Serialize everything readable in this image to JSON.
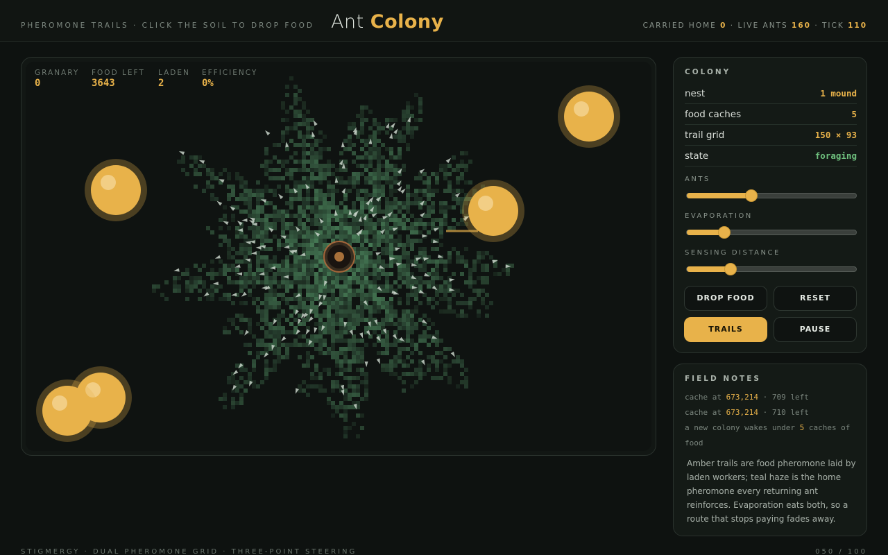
{
  "header": {
    "tagline": "Pheromone trails · click the soil to drop food",
    "title_light": "Ant",
    "title_accent": "Colony",
    "stats": {
      "carried_home_label": "Carried home",
      "carried_home": "0",
      "live_ants_label": "Live ants",
      "live_ants": "160",
      "tick_label": "Tick",
      "tick": "110"
    }
  },
  "hud": [
    {
      "label": "Granary",
      "value": "0"
    },
    {
      "label": "Food left",
      "value": "3643"
    },
    {
      "label": "Laden",
      "value": "2"
    },
    {
      "label": "Efficiency",
      "value": "0%"
    }
  ],
  "colony": {
    "title": "Colony",
    "rows": [
      {
        "key": "nest",
        "value": "1 mound"
      },
      {
        "key": "food caches",
        "value": "5"
      },
      {
        "key": "trail grid",
        "value": "150 × 93"
      },
      {
        "key": "state",
        "value": "foraging"
      }
    ],
    "sliders": [
      {
        "label": "Ants",
        "level": 0.38
      },
      {
        "label": "Evaporation",
        "level": 0.22
      },
      {
        "label": "Sensing distance",
        "level": 0.26
      }
    ],
    "buttons": {
      "drop_food": "Drop food",
      "reset": "Reset",
      "trails": "Trails",
      "pause": "Pause"
    }
  },
  "notes": {
    "title": "Field notes",
    "lines": [
      {
        "pre": "cache at ",
        "hl": "673,214",
        "post": " · 709 left"
      },
      {
        "pre": "cache at ",
        "hl": "673,214",
        "post": " · 710 left"
      },
      {
        "pre": "a new colony wakes under ",
        "hl": "5",
        "post": " caches of food"
      }
    ],
    "paragraph": "Amber trails are food pheromone laid by laden workers; teal haze is the home pheromone every returning ant reinforces. Evaporation eats both, so a route that stops paying fades away."
  },
  "footer": {
    "left": "Stigmergy · dual pheromone grid · three-point steering",
    "right": "050 / 100"
  },
  "colors": {
    "accent": "#e8b24a",
    "trail": "#4f8a60",
    "state_green": "#6fc07e"
  }
}
